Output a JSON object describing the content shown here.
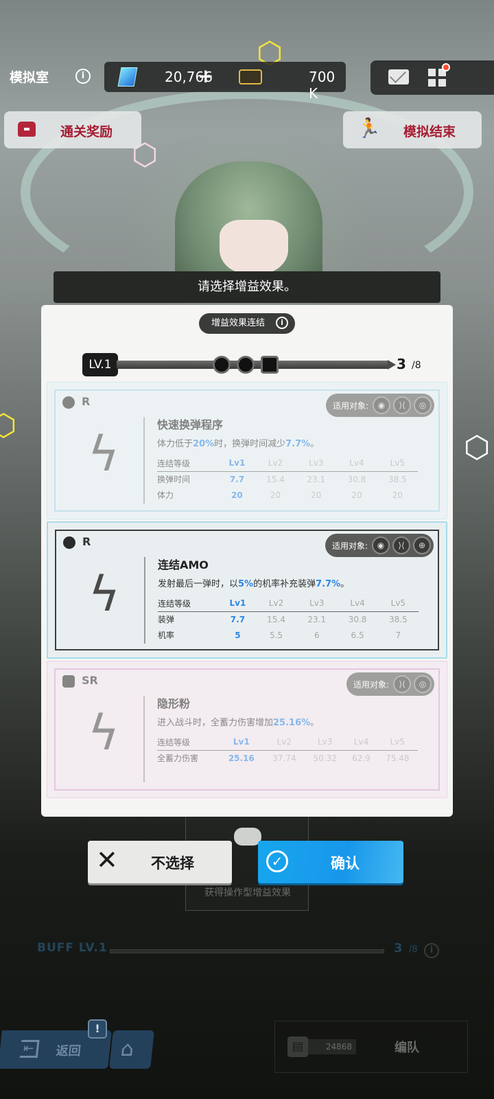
{
  "topbar": {
    "room_title": "模拟室",
    "info_symbol": "i",
    "gem_value": "20,766",
    "plus_symbol": "+",
    "credit_value": "700 K"
  },
  "actions": {
    "reward_label": "通关奖励",
    "end_label": "模拟结束"
  },
  "banner": "请选择增益效果。",
  "panel": {
    "synergy_label": "增益效果连结",
    "level_badge": "LV.1",
    "progress_current": "3",
    "progress_total": "/8",
    "target_label": "适用对象:",
    "table_header": [
      "连结等级",
      "Lv1",
      "Lv2",
      "Lv3",
      "Lv4",
      "Lv5"
    ],
    "cards": [
      {
        "rarity": "R",
        "title": "快速换弹程序",
        "desc_pre": "体力低于",
        "desc_hl1": "20%",
        "desc_mid": "时，换弹时间减少",
        "desc_hl2": "7.7%",
        "desc_post": "。",
        "rows": [
          [
            "换弹时间",
            "7.7",
            "15.4",
            "23.1",
            "30.8",
            "38.5"
          ],
          [
            "体力",
            "20",
            "20",
            "20",
            "20",
            "20"
          ]
        ],
        "targets": [
          "target-a-icon",
          "target-b-icon",
          "target-c-icon"
        ]
      },
      {
        "rarity": "R",
        "title": "连结AMO",
        "desc_pre": "发射最后一弹时，以",
        "desc_hl1": "5%",
        "desc_mid": "的机率补充装弹",
        "desc_hl2": "7.7%",
        "desc_post": "。",
        "rows": [
          [
            "装弹",
            "7.7",
            "15.4",
            "23.1",
            "30.8",
            "38.5"
          ],
          [
            "机率",
            "5",
            "5.5",
            "6",
            "6.5",
            "7"
          ]
        ],
        "targets": [
          "target-a-icon",
          "target-b-icon",
          "target-d-icon"
        ]
      },
      {
        "rarity": "SR",
        "title": "隐形粉",
        "desc_pre": "进入战斗时，全蓄力伤害增加",
        "desc_hl1": "25.16%",
        "desc_mid": "。",
        "desc_hl2": "",
        "desc_post": "",
        "rows": [
          [
            "全蓄力伤害",
            "25.16",
            "37.74",
            "50.32",
            "62.9",
            "75.48"
          ]
        ],
        "targets": [
          "target-b-icon",
          "target-c-icon"
        ]
      }
    ]
  },
  "buttons": {
    "skip_label": "不选择",
    "confirm_label": "确认"
  },
  "background": {
    "gamepad_label": "获得操作型增益效果",
    "buff_label": "BUFF LV.1",
    "buff_current": "3",
    "buff_total": "/8",
    "back_label": "返回",
    "alert_symbol": "!",
    "team_power": "24868",
    "team_label": "编队"
  },
  "colors": {
    "accent_blue": "#2c86e6",
    "confirm_blue": "#1897ea",
    "reward_red": "#a51d33",
    "notification_red": "#ff4c2d"
  }
}
